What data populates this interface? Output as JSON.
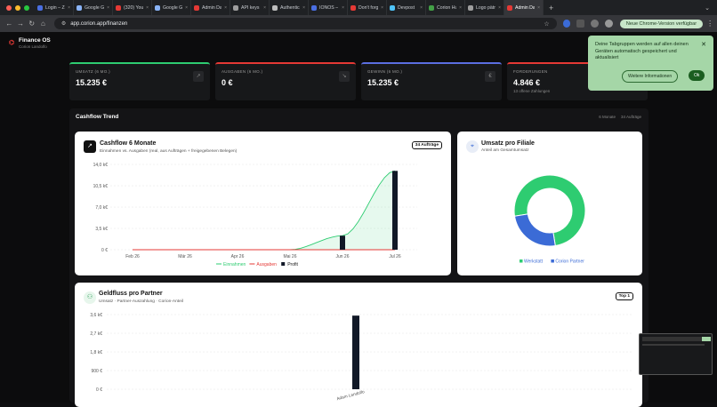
{
  "browser": {
    "tabs": [
      {
        "label": "Login – Zu",
        "color": "#4a6fe3",
        "active": false
      },
      {
        "label": "Google Ge",
        "color": "#8ab4f8",
        "active": false
      },
      {
        "label": "(320) Your",
        "color": "#e53935",
        "active": false
      },
      {
        "label": "Google Ge",
        "color": "#8ab4f8",
        "active": false
      },
      {
        "label": "Admin Das",
        "color": "#e53935",
        "active": false
      },
      {
        "label": "API keys |",
        "color": "#9e9e9e",
        "active": false
      },
      {
        "label": "Authenticat",
        "color": "#bdbdbd",
        "active": false
      },
      {
        "label": "IONOS – S",
        "color": "#4a6fe3",
        "active": false
      },
      {
        "label": "Don't forge",
        "color": "#e53935",
        "active": false
      },
      {
        "label": "Devpost",
        "color": "#4fc3f7",
        "active": false
      },
      {
        "label": "Corion Hu",
        "color": "#43a047",
        "active": false
      },
      {
        "label": "Logo pätro",
        "color": "#9e9e9e",
        "active": false
      },
      {
        "label": "Admin Das",
        "color": "#e53935",
        "active": true
      }
    ],
    "url": "app.corion.app/finanzen",
    "update_label": "Neue Chrome-Version verfügbar"
  },
  "app": {
    "name": "Finance OS",
    "subtitle": "Corion Landolfo"
  },
  "kpis": [
    {
      "label": "UMSATZ (6 MO.)",
      "value": "15.235 €",
      "sub": "",
      "color": "#2ecc71",
      "icon": "↗"
    },
    {
      "label": "AUSGABEN (6 MO.)",
      "value": "0 €",
      "sub": "",
      "color": "#e53935",
      "icon": "↘"
    },
    {
      "label": "GEWINN (6 MO.)",
      "value": "15.235 €",
      "sub": "",
      "color": "#5b6ee1",
      "icon": "€"
    },
    {
      "label": "FORDERUNGEN",
      "value": "4.846 €",
      "sub": "13 offene Zahlungen",
      "color": "#e53935",
      "icon": "!"
    }
  ],
  "toast": {
    "text": "Deine Tabgruppen werden auf allen deinen Geräten automatisch gespeichert und aktualisiert",
    "more": "Weitere Informationen",
    "ok": "Ok"
  },
  "section": {
    "title": "Cashflow Trend",
    "filters": [
      "6 Monate",
      "34 Aufträge"
    ]
  },
  "cashflow": {
    "title": "Cashflow 6 Monate",
    "subtitle": "Einnahmen vs. Ausgaben (real, aus Aufträgen + freigegebenen Belegen)",
    "badge": "34 Aufträge"
  },
  "filiale": {
    "title": "Umsatz pro Filiale",
    "subtitle": "Anteil am Gesamtumsatz"
  },
  "partner": {
    "title": "Geldfluss pro Partner",
    "subtitle": "Umsatz · Partner-Auszahlung · Corion-Anteil",
    "badge": "Top 1"
  },
  "chart_data": [
    {
      "type": "line",
      "categories": [
        "Feb 26",
        "Mär 26",
        "Apr 26",
        "Mai 26",
        "Jun 26",
        "Jul 26"
      ],
      "yticks": [
        "0 €",
        "3,5 k€",
        "7,0 k€",
        "10,5 k€",
        "14,0 k€"
      ],
      "ylim": [
        0,
        14000
      ],
      "series": [
        {
          "name": "Einnahmen",
          "type": "area",
          "color": "#2ecc71",
          "values": [
            0,
            0,
            0,
            0,
            2300,
            12935
          ]
        },
        {
          "name": "Ausgaben",
          "type": "line",
          "color": "#e53935",
          "values": [
            0,
            0,
            0,
            0,
            0,
            0
          ]
        },
        {
          "name": "Profit",
          "type": "bar",
          "color": "#111827",
          "values": [
            0,
            0,
            0,
            0,
            2300,
            12935
          ]
        }
      ]
    },
    {
      "type": "pie",
      "series": [
        {
          "name": "Werkstatt",
          "color": "#2ecc71",
          "value": 75
        },
        {
          "name": "Corion Partner",
          "color": "#3b6bd6",
          "value": 25
        }
      ]
    },
    {
      "type": "bar",
      "categories": [
        "Adam Landolfo"
      ],
      "yticks": [
        "0 €",
        "900 €",
        "1,8 k€",
        "2,7 k€",
        "3,6 k€"
      ],
      "ylim": [
        0,
        3600
      ],
      "series": [
        {
          "name": "Umsatz",
          "color": "#111827",
          "values": [
            3550
          ]
        }
      ]
    }
  ]
}
